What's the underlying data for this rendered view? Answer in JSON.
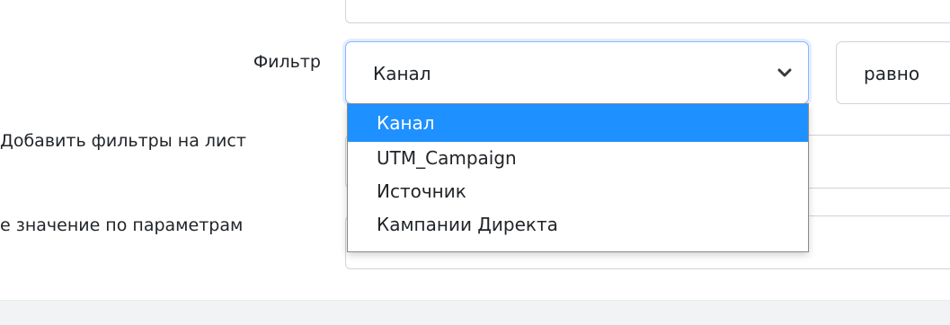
{
  "form": {
    "filter_label": "Фильтр",
    "add_filters_label": "Добавить фильтры на лист",
    "value_by_params_label": "е значение по параметрам"
  },
  "filter_select": {
    "value": "Канал",
    "options": [
      "Канал",
      "UTM_Campaign",
      "Источник",
      "Кампании Директа"
    ]
  },
  "operator_select": {
    "value": "равно"
  },
  "colors": {
    "accent": "#1e90ff",
    "focus_border": "#86b7fe",
    "border": "#ced4da"
  }
}
